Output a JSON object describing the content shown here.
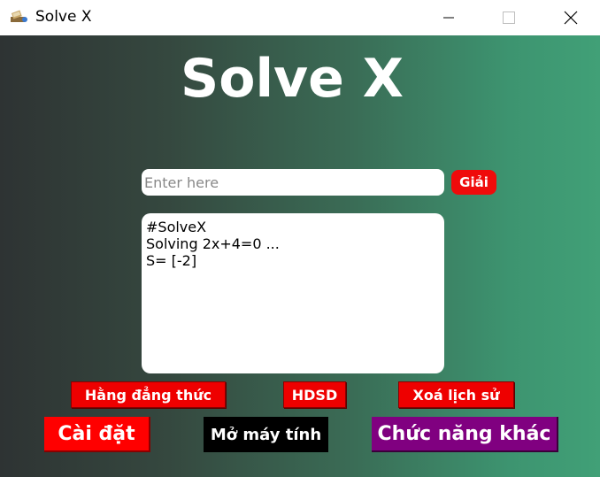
{
  "window": {
    "title": "Solve X",
    "icon": "app-icon"
  },
  "header": {
    "title": "Solve X"
  },
  "input": {
    "placeholder": "Enter here",
    "value": ""
  },
  "buttons": {
    "solve": "Giải",
    "identities": "Hằng đẳng thức",
    "guide": "HDSD",
    "clear_history": "Xoá lịch sử",
    "settings": "Cài đặt",
    "open_calculator": "Mở máy tính",
    "other_functions": "Chức năng khác"
  },
  "output": {
    "lines": [
      "#SolveX",
      "Solving 2x+4=0 ...",
      "S= [-2]"
    ]
  },
  "colors": {
    "red_button": "#ee0000",
    "purple_button": "#800080",
    "black_button": "#000000",
    "gradient_start": "#2e3333",
    "gradient_end": "#41a077"
  }
}
